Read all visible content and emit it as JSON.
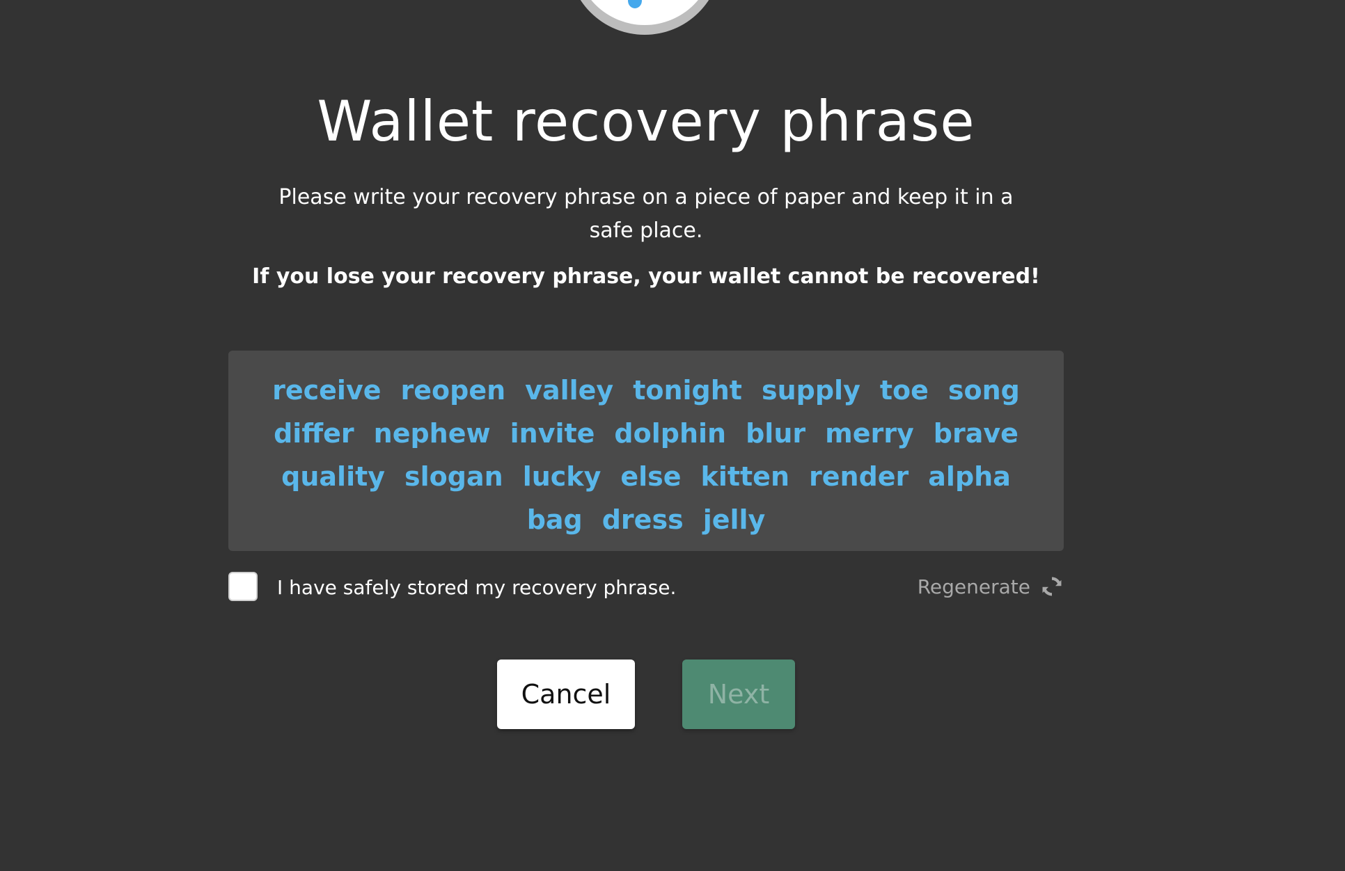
{
  "dialog": {
    "title": "Wallet recovery phrase",
    "description": "Please write your recovery phrase on a piece of paper and keep it in a safe place.",
    "warning": "If you lose your recovery phrase, your wallet cannot be recovered!"
  },
  "phrase": {
    "words": [
      "receive",
      "reopen",
      "valley",
      "tonight",
      "supply",
      "toe",
      "song",
      "differ",
      "nephew",
      "invite",
      "dolphin",
      "blur",
      "merry",
      "brave",
      "quality",
      "slogan",
      "lucky",
      "else",
      "kitten",
      "render",
      "alpha",
      "bag",
      "dress",
      "jelly"
    ]
  },
  "confirm": {
    "label": "I have safely stored my recovery phrase.",
    "checked": false
  },
  "regenerate": {
    "label": "Regenerate",
    "icon": "refresh-icon"
  },
  "actions": {
    "cancel_label": "Cancel",
    "next_label": "Next",
    "next_enabled": false
  },
  "colors": {
    "background": "#333333",
    "phrase_box": "#4a4a4a",
    "word": "#5ab7ea",
    "next_button": "#4e8a72"
  }
}
